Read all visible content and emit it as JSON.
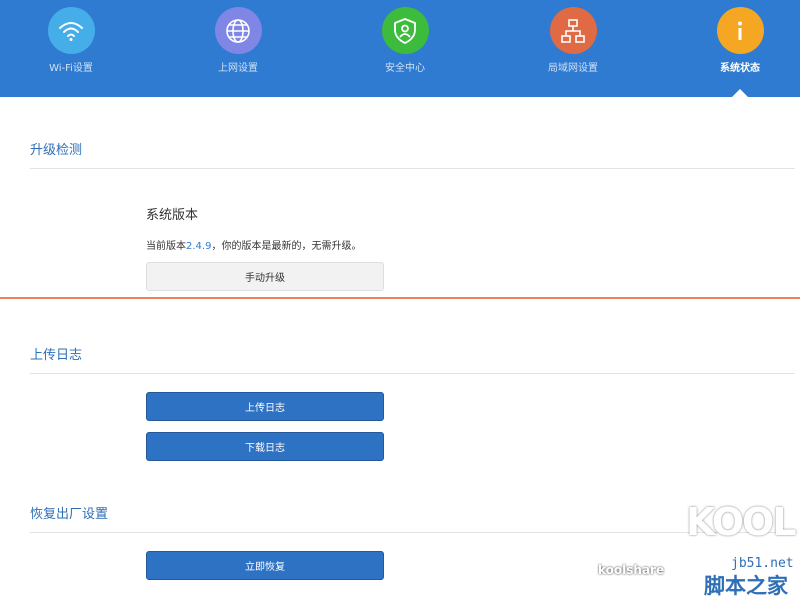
{
  "nav": {
    "items": [
      {
        "label": "Wi-Fi设置",
        "icon": "wifi-icon",
        "color": "#45aee8"
      },
      {
        "label": "上网设置",
        "icon": "globe-icon",
        "color": "#7f86e6"
      },
      {
        "label": "安全中心",
        "icon": "shield-icon",
        "color": "#3dbb3c"
      },
      {
        "label": "局域网设置",
        "icon": "network-icon",
        "color": "#e06a43"
      },
      {
        "label": "系统状态",
        "icon": "info-icon",
        "color": "#f5a623"
      }
    ],
    "active_index": 4,
    "bar_color": "#2e7bd1"
  },
  "upgrade": {
    "title": "升级检测",
    "subtitle": "系统版本",
    "version_prefix": "当前版本",
    "version": "2.4.9",
    "version_suffix": "，你的版本是最新的，无需升级。",
    "button": "手动升级"
  },
  "logs": {
    "title": "上传日志",
    "upload_button": "上传日志",
    "download_button": "下载日志"
  },
  "reset": {
    "title": "恢复出厂设置",
    "button": "立即恢复"
  },
  "watermark": {
    "brand": "KOOL",
    "koolshare": "koolshare",
    "site": "jb51.net",
    "site_name": "脚本之家"
  }
}
